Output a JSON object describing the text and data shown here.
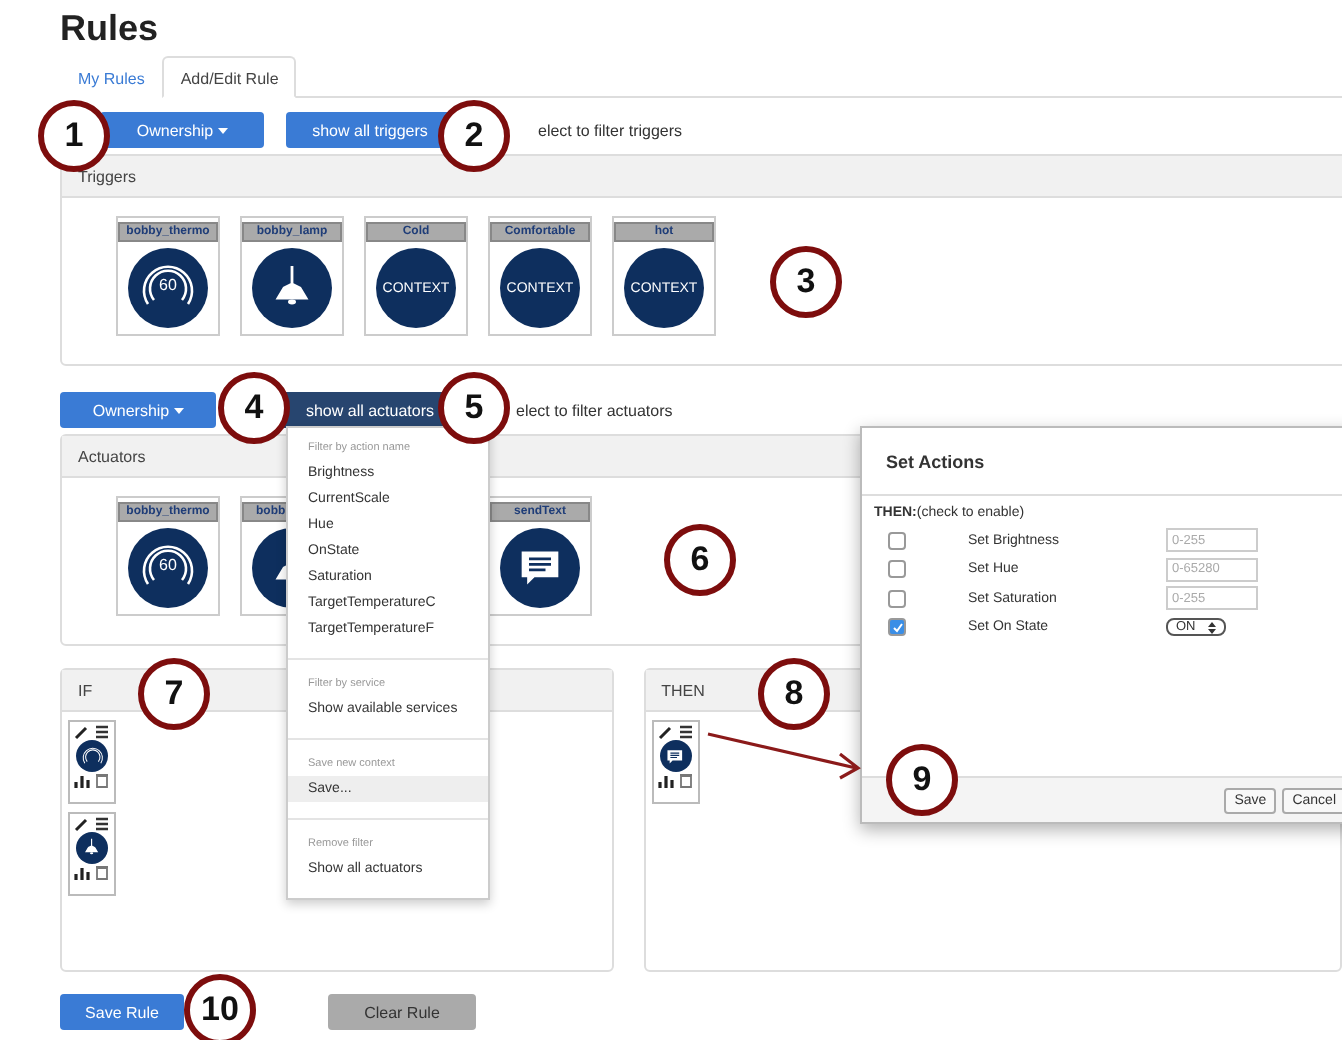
{
  "page_title": "Rules",
  "tabs": [
    {
      "label": "My Rules",
      "selected": false
    },
    {
      "label": "Add/Edit Rule",
      "selected": true
    }
  ],
  "trigger_filter": {
    "ownership_button": "Ownership",
    "filter_button": "show all triggers",
    "hint": "elect to filter triggers",
    "open": false
  },
  "triggers": {
    "title": "Triggers",
    "tiles": [
      {
        "name": "bobby_thermo",
        "kind": "thermostat",
        "reading": "60",
        "truncated": false
      },
      {
        "name": "bobby_lamp",
        "kind": "lamp",
        "truncated": false
      },
      {
        "name": "Cold",
        "kind": "context",
        "label": "CONTEXT",
        "truncated": false
      },
      {
        "name": "Comfortable",
        "kind": "context",
        "label": "CONTEXT",
        "truncated": false
      },
      {
        "name": "hot",
        "kind": "context",
        "label": "CONTEXT",
        "truncated": false
      }
    ]
  },
  "actuator_filter": {
    "ownership_button": "Ownership",
    "filter_button": "show all actuators",
    "hint": "elect to filter actuators",
    "open": true
  },
  "actuators": {
    "title": "Actuators",
    "tiles": [
      {
        "name": "bobby_thermo",
        "kind": "thermostat",
        "reading": "60",
        "truncated": false
      },
      {
        "name": "bobb",
        "kind": "lamp",
        "truncated": true
      },
      {
        "name": "sendText",
        "kind": "message",
        "truncated": false
      }
    ]
  },
  "actuator_menu": {
    "sections": [
      {
        "header": "Filter by action name",
        "items": [
          {
            "label": "Brightness",
            "highlighted": false
          },
          {
            "label": "CurrentScale",
            "highlighted": false
          },
          {
            "label": "Hue",
            "highlighted": false
          },
          {
            "label": "OnState",
            "highlighted": false
          },
          {
            "label": "Saturation",
            "highlighted": false
          },
          {
            "label": "TargetTemperatureC",
            "highlighted": false
          },
          {
            "label": "TargetTemperatureF",
            "highlighted": false
          }
        ]
      },
      {
        "header": "Filter by service",
        "items": [
          {
            "label": "Show available services",
            "highlighted": false
          }
        ]
      },
      {
        "header": "Save new context",
        "items": [
          {
            "label": "Save...",
            "highlighted": true
          }
        ]
      },
      {
        "header": "Remove filter",
        "items": [
          {
            "label": "Show all actuators",
            "highlighted": false
          }
        ]
      }
    ]
  },
  "if_panel": {
    "title": "IF",
    "cards": [
      {
        "kind": "thermostat"
      },
      {
        "kind": "lamp"
      }
    ]
  },
  "then_panel": {
    "title": "THEN",
    "cards": [
      {
        "kind": "message"
      }
    ]
  },
  "set_actions": {
    "title": "Set Actions",
    "prompt": "**THEN:**(check to enable)",
    "rows": [
      {
        "kind": "input",
        "label": "Set Brightness",
        "checked": false,
        "placeholder": "0-255"
      },
      {
        "kind": "input",
        "label": "Set Hue",
        "checked": false,
        "placeholder": "0-65280"
      },
      {
        "kind": "input",
        "label": "Set Saturation",
        "checked": false,
        "placeholder": "0-255"
      },
      {
        "kind": "select",
        "label": "Set On State",
        "checked": true,
        "value": "ON"
      }
    ],
    "buttons": [
      "Save",
      "Cancel"
    ]
  },
  "save_button": "Save Rule",
  "clear_button": "Clear Rule",
  "callouts": [
    "1",
    "2",
    "3",
    "4",
    "5",
    "6",
    "7",
    "8",
    "9",
    "10"
  ]
}
